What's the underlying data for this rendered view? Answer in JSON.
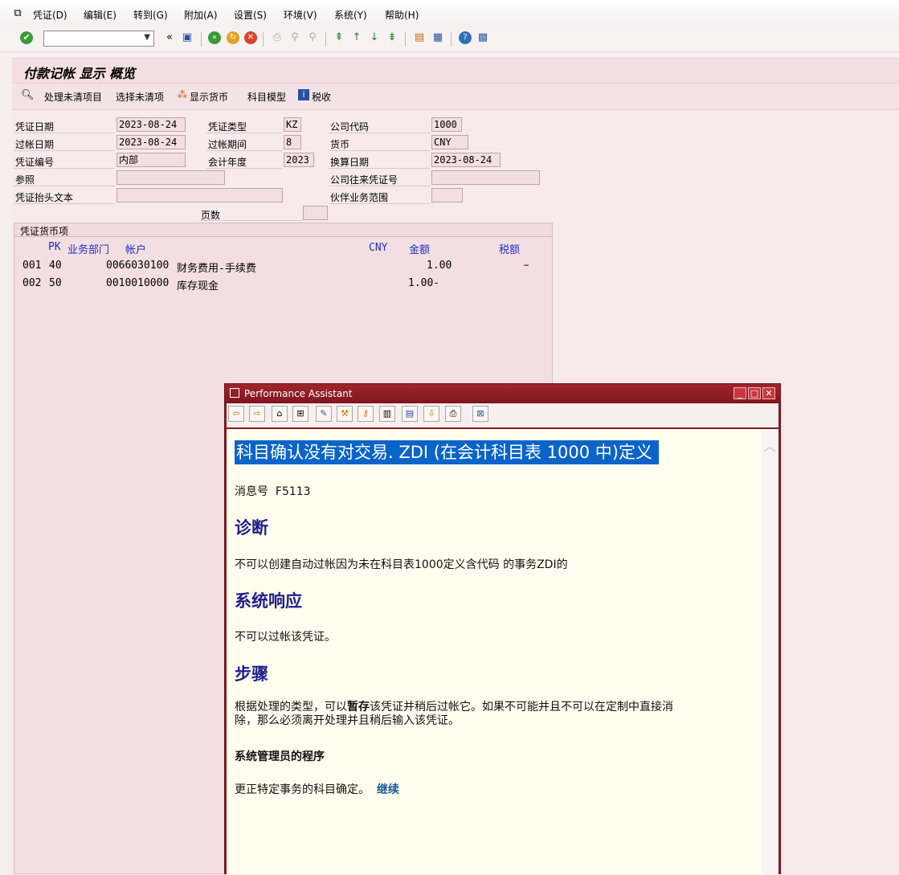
{
  "menu": {
    "items": [
      "凭证(D)",
      "编辑(E)",
      "转到(G)",
      "附加(A)",
      "设置(S)",
      "环境(V)",
      "系统(Y)",
      "帮助(H)"
    ]
  },
  "toolbar": {
    "command_value": "",
    "icons": [
      "enter-icon",
      "back-icon",
      "save-icon",
      "exit-icon",
      "cancel-icon",
      "print-icon",
      "find-icon",
      "find-next-icon",
      "first-page-icon",
      "prev-page-icon",
      "next-page-icon",
      "last-page-icon",
      "new-session-icon",
      "shortcut-icon",
      "help-icon",
      "layout-icon"
    ]
  },
  "screen": {
    "title": "付款记帐 显示 概览",
    "app_buttons": [
      "处理未清项目",
      "选择未清项",
      "显示货币",
      "科目模型",
      "税收"
    ]
  },
  "header": {
    "labels": {
      "doc_date": "凭证日期",
      "post_date": "过帐日期",
      "doc_no": "凭证编号",
      "ref": "参照",
      "header_text": "凭证抬头文本",
      "doc_type": "凭证类型",
      "period": "过帐期间",
      "fiscal_year": "会计年度",
      "company_code": "公司代码",
      "currency": "货币",
      "trans_date": "换算日期",
      "intercompany": "公司往来凭证号",
      "partner_ba": "伙伴业务范围",
      "pages": "页数"
    },
    "values": {
      "doc_date": "2023-08-24",
      "post_date": "2023-08-24",
      "doc_no": "内部",
      "ref": "",
      "header_text": "",
      "doc_type": "KZ",
      "period": "8",
      "fiscal_year": "2023",
      "company_code": "1000",
      "currency": "CNY",
      "trans_date": "2023-08-24",
      "intercompany": "",
      "partner_ba": "",
      "pages": ""
    }
  },
  "items": {
    "group_title": "凭证货币项",
    "columns": {
      "pk": "PK",
      "ba": "业务部门",
      "account": "帐户",
      "cur": "CNY",
      "amount": "金额",
      "tax": "税额"
    },
    "rows": [
      {
        "no": "001",
        "pk": "40",
        "account": "0066030100",
        "name": "财务费用-手续费",
        "amount": "1.00",
        "tax": "…"
      },
      {
        "no": "002",
        "pk": "50",
        "account": "0010010000",
        "name": "库存现金",
        "amount": "1.00-",
        "tax": ""
      }
    ]
  },
  "perf_assistant": {
    "title": "Performance Assistant",
    "message_title": "科目确认没有对交易. ZDI (在会计科目表 1000 中)定义",
    "message_no_label": "消息号",
    "message_no": "F5113",
    "diagnosis_head": "诊断",
    "diagnosis_text": "不可以创建自动过帐因为未在科目表1000定义含代码 的事务ZDI的",
    "response_head": "系统响应",
    "response_text": "不可以过帐该凭证。",
    "procedure_head": "步骤",
    "procedure_text_a": "根据处理的类型，可以",
    "procedure_text_bold": "暂存",
    "procedure_text_b": "该凭证并稍后过帐它。如果不可能并且不可以在定制中直接消",
    "procedure_text_c": "除，那么必须离开处理并且稍后输入该凭证。",
    "admin_head": "系统管理员的程序",
    "admin_text": "更正特定事务的科目确定。",
    "continue_link": "继续"
  }
}
